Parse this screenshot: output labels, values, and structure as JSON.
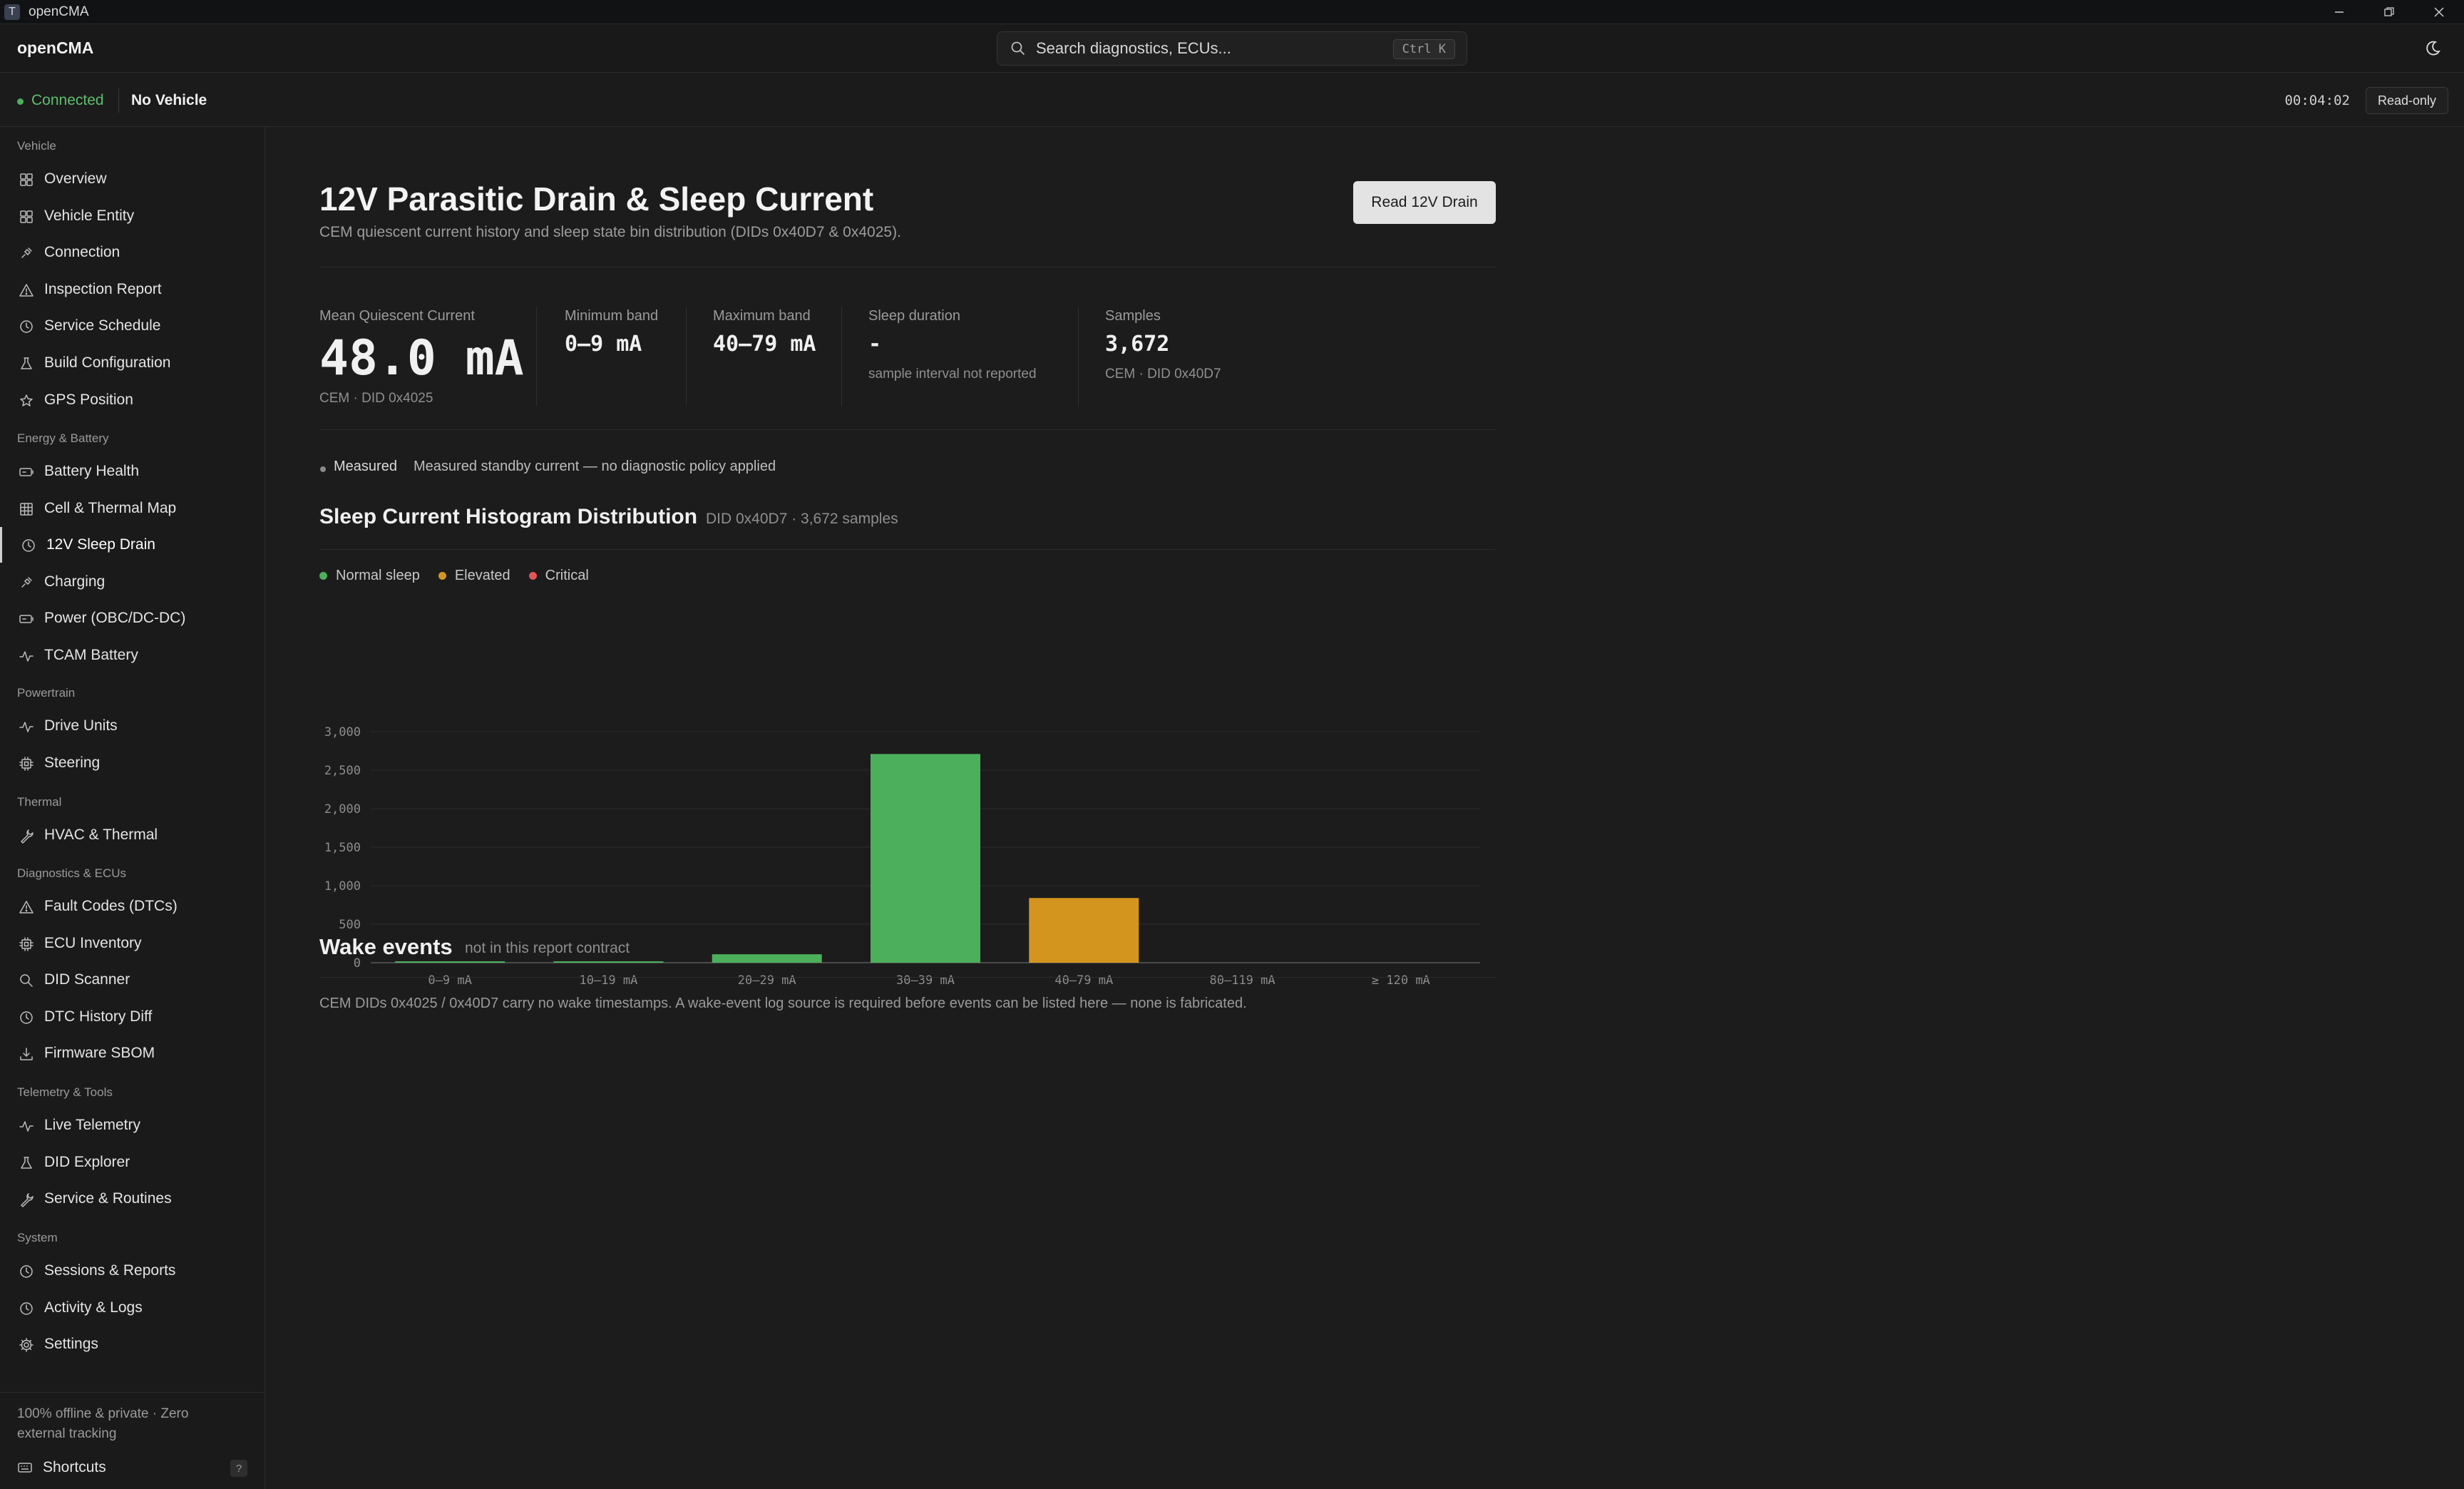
{
  "window": {
    "title": "openCMA",
    "app_icon_glyph": "T"
  },
  "header": {
    "brand": "openCMA",
    "search_placeholder": "Search diagnostics, ECUs...",
    "search_shortcut": "Ctrl K",
    "theme_icon": "moon-icon"
  },
  "status": {
    "connection": "Connected",
    "vehicle": "No Vehicle",
    "elapsed": "00:04:02",
    "mode": "Read-only",
    "connection_color": "#4caf5c"
  },
  "sidebar": {
    "sections": [
      {
        "label": "Vehicle",
        "items": [
          {
            "label": "Overview",
            "icon": "grid-icon"
          },
          {
            "label": "Vehicle Entity",
            "icon": "grid-icon"
          },
          {
            "label": "Connection",
            "icon": "plug-icon"
          },
          {
            "label": "Inspection Report",
            "icon": "warning-triangle-icon"
          },
          {
            "label": "Service Schedule",
            "icon": "clock-icon"
          },
          {
            "label": "Build Configuration",
            "icon": "flask-icon"
          },
          {
            "label": "GPS Position",
            "icon": "star-icon"
          }
        ]
      },
      {
        "label": "Energy & Battery",
        "items": [
          {
            "label": "Battery Health",
            "icon": "battery-icon"
          },
          {
            "label": "Cell & Thermal Map",
            "icon": "table-grid-icon"
          },
          {
            "label": "12V Sleep Drain",
            "icon": "clock-icon",
            "active": true
          },
          {
            "label": "Charging",
            "icon": "plug-icon"
          },
          {
            "label": "Power (OBC/DC-DC)",
            "icon": "battery-icon"
          },
          {
            "label": "TCAM Battery",
            "icon": "pulse-icon"
          }
        ]
      },
      {
        "label": "Powertrain",
        "items": [
          {
            "label": "Drive Units",
            "icon": "pulse-icon"
          },
          {
            "label": "Steering",
            "icon": "chip-icon"
          }
        ]
      },
      {
        "label": "Thermal",
        "items": [
          {
            "label": "HVAC & Thermal",
            "icon": "wrench-icon"
          }
        ]
      },
      {
        "label": "Diagnostics & ECUs",
        "items": [
          {
            "label": "Fault Codes (DTCs)",
            "icon": "warning-triangle-icon"
          },
          {
            "label": "ECU Inventory",
            "icon": "chip-icon"
          },
          {
            "label": "DID Scanner",
            "icon": "search-icon"
          },
          {
            "label": "DTC History Diff",
            "icon": "clock-icon"
          },
          {
            "label": "Firmware SBOM",
            "icon": "download-icon"
          }
        ]
      },
      {
        "label": "Telemetry & Tools",
        "items": [
          {
            "label": "Live Telemetry",
            "icon": "pulse-icon"
          },
          {
            "label": "DID Explorer",
            "icon": "flask-icon"
          },
          {
            "label": "Service & Routines",
            "icon": "wrench-icon"
          }
        ]
      },
      {
        "label": "System",
        "items": [
          {
            "label": "Sessions & Reports",
            "icon": "clock-icon"
          },
          {
            "label": "Activity & Logs",
            "icon": "clock-icon"
          },
          {
            "label": "Settings",
            "icon": "gear-icon"
          }
        ]
      }
    ],
    "footer": {
      "privacy": "100% offline & private · Zero external tracking",
      "shortcuts_label": "Shortcuts",
      "shortcuts_key": "?"
    }
  },
  "page": {
    "title": "12V Parasitic Drain & Sleep Current",
    "subtitle": "CEM quiescent current history and sleep state bin distribution (DIDs 0x40D7 & 0x4025).",
    "read_button": "Read 12V Drain",
    "stats": {
      "mean": {
        "label": "Mean Quiescent Current",
        "value": "48.0 mA",
        "sub": "CEM · DID 0x4025"
      },
      "min": {
        "label": "Minimum band",
        "value": "0–9 mA"
      },
      "max": {
        "label": "Maximum band",
        "value": "40–79 mA"
      },
      "sleep": {
        "label": "Sleep duration",
        "value": "-",
        "sub": "sample interval not reported"
      },
      "samples": {
        "label": "Samples",
        "value": "3,672",
        "sub": "CEM · DID 0x40D7"
      }
    },
    "measured": {
      "tag": "Measured",
      "description": "Measured standby current — no diagnostic policy applied"
    },
    "histogram": {
      "title": "Sleep Current Histogram Distribution",
      "meta": "DID 0x40D7 · 3,672 samples",
      "legend": [
        {
          "label": "Normal sleep",
          "color": "#4caf5c"
        },
        {
          "label": "Elevated",
          "color": "#d4951f"
        },
        {
          "label": "Critical",
          "color": "#e0545a"
        }
      ]
    },
    "wake": {
      "title": "Wake events",
      "meta": "not in this report contract",
      "note": "CEM DIDs 0x4025 / 0x40D7 carry no wake timestamps. A wake-event log source is required before events can be listed here — none is fabricated."
    }
  },
  "chart_data": {
    "type": "bar",
    "categories": [
      "0–9 mA",
      "10–19 mA",
      "20–29 mA",
      "30–39 mA",
      "40–79 mA",
      "80–119 mA",
      "≥ 120 mA"
    ],
    "values": [
      5,
      3,
      110,
      2710,
      840,
      0,
      0
    ],
    "bar_status": [
      "normal",
      "normal",
      "normal",
      "normal",
      "elevated",
      "normal",
      "normal"
    ],
    "yticks": [
      "0",
      "500",
      "1,000",
      "1,500",
      "2,000",
      "2,500",
      "3,000"
    ],
    "ylim": [
      0,
      3000
    ],
    "grid": true,
    "legend_position": "top-left",
    "colors": {
      "normal": "#4caf5c",
      "elevated": "#d4951f",
      "critical": "#e0545a"
    }
  }
}
